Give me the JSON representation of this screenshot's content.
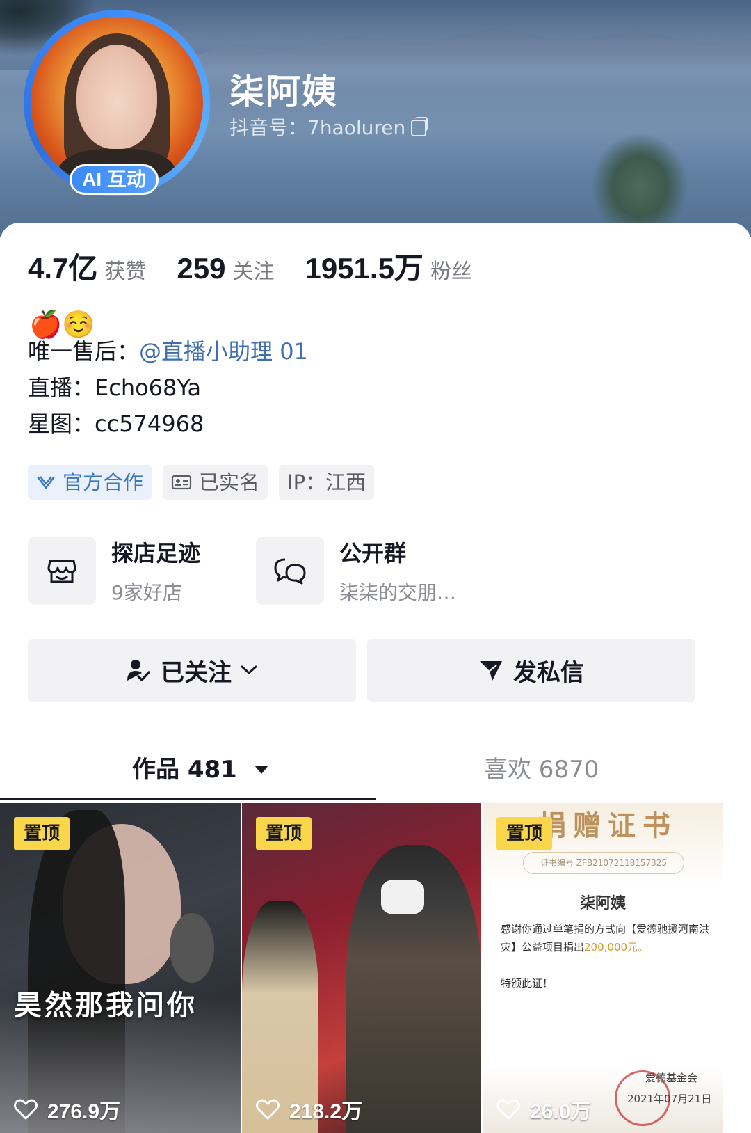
{
  "profile": {
    "name": "柒阿姨",
    "douyin_id": "抖音号：7haoluren",
    "avatar_badge": "AI 互动"
  },
  "stats": [
    {
      "value": "4.7亿",
      "label": "获赞"
    },
    {
      "value": "259",
      "label": "关注"
    },
    {
      "value": "1951.5万",
      "label": "粉丝"
    }
  ],
  "bio": {
    "emoji": "🍎☺️",
    "after_sales_label": "唯一售后：",
    "after_sales_link": "@直播小助理 01",
    "live": "直播：Echo68Ya",
    "xingtu": "星图：cc574968"
  },
  "tags": {
    "official": "官方合作",
    "verified": "已实名",
    "ip": "IP：江西"
  },
  "cards": {
    "shop": {
      "title": "探店足迹",
      "subtitle": "9家好店"
    },
    "group": {
      "title": "公开群",
      "subtitle": "柒柒的交朋…"
    }
  },
  "buttons": {
    "following": "已关注",
    "message": "发私信"
  },
  "tabs": {
    "works": "作品 481",
    "likes": "喜欢 6870"
  },
  "videos": [
    {
      "pin": "置顶",
      "likes": "276.9万",
      "caption": "昊然那我问你"
    },
    {
      "pin": "置顶",
      "likes": "218.2万",
      "caption": ""
    },
    {
      "pin": "置顶",
      "likes": "26.0万",
      "cert": {
        "title": "捐赠证书",
        "number": "证书编号 ZFB21072118157325",
        "name": "柒阿姨",
        "text1": "感谢你通过单笔捐的方式向【爱德驰援河南洪灾】公益项目捐出",
        "amount": "200,000元。",
        "text2": "特颁此证！",
        "org": "爱德基金会",
        "date": "2021年07月21日"
      }
    }
  ],
  "colors": {
    "avatar_ring": "#3e8ef7",
    "link": "#3f6fb0",
    "pin": "#f9d64a"
  }
}
